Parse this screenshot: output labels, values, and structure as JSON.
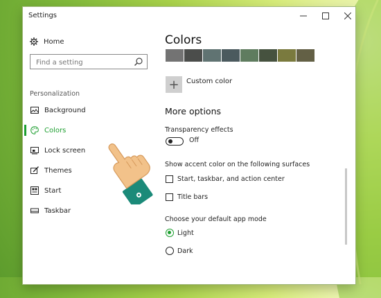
{
  "window": {
    "title": "Settings"
  },
  "sidebar": {
    "home": "Home",
    "search_placeholder": "Find a setting",
    "section": "Personalization",
    "items": [
      {
        "label": "Background",
        "icon": "picture-icon"
      },
      {
        "label": "Colors",
        "icon": "palette-icon",
        "active": true
      },
      {
        "label": "Lock screen",
        "icon": "lock-screen-icon"
      },
      {
        "label": "Themes",
        "icon": "brush-icon"
      },
      {
        "label": "Start",
        "icon": "start-icon"
      },
      {
        "label": "Taskbar",
        "icon": "taskbar-icon"
      }
    ]
  },
  "main": {
    "heading": "Colors",
    "swatches": [
      "#737373",
      "#4b4d4b",
      "#607372",
      "#4b5a5e",
      "#5f7c5f",
      "#46523f",
      "#7a7a3e",
      "#636045"
    ],
    "custom_color": "Custom color",
    "more_options": "More options",
    "transparency_label": "Transparency effects",
    "transparency_state": "Off",
    "accent_surfaces_label": "Show accent color on the following surfaces",
    "surface_start": "Start, taskbar, and action center",
    "surface_titlebars": "Title bars",
    "app_mode_label": "Choose your default app mode",
    "mode_light": "Light",
    "mode_dark": "Dark"
  },
  "colors": {
    "accent": "#1c9e2f",
    "sleeve": "#1b8a79",
    "skin": "#f2c28a"
  }
}
